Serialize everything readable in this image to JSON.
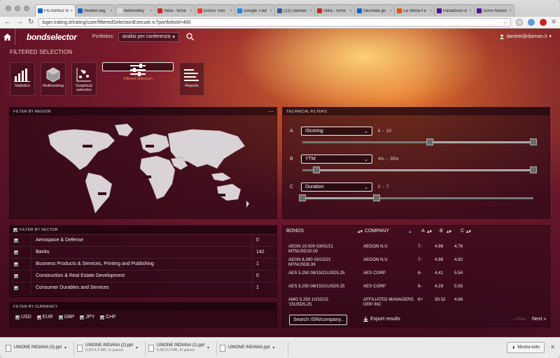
{
  "browser": {
    "tabs": [
      {
        "title": "FILTERED SE",
        "color": "#1565c0",
        "active": true
      },
      {
        "title": "modelli seg",
        "color": "#1565c0"
      },
      {
        "title": "federvolley",
        "color": "#dddddd"
      },
      {
        "title": "India - forse",
        "color": "#c62828"
      },
      {
        "title": "Enrico Tres",
        "color": "#e53935"
      },
      {
        "title": "Google Trad",
        "color": "#1e88e5"
      },
      {
        "title": "(12) Diaman",
        "color": "#3b5998"
      },
      {
        "title": "India - forse",
        "color": "#c62828"
      },
      {
        "title": "Seconda gu",
        "color": "#1565c0"
      },
      {
        "title": "La Storia Fa",
        "color": "#e65100"
      },
      {
        "title": "Paradosso d",
        "color": "#4a148c"
      },
      {
        "title": "Scrivi Nuovo",
        "color": "#4a148c"
      }
    ],
    "url": "login.irating.it/irating/user/filteredSelectionExecute.ic?portfolioId=460"
  },
  "header": {
    "logo": "bondselector",
    "portfolios_label": "Portfolios:",
    "portfolio_selected": "analisi per conferenza",
    "user": "daniele@diaman.it"
  },
  "page_title": "FILTERED SELECTION",
  "nav_icons": [
    {
      "label": "Statistics",
      "icon": "bar-chart-icon"
    },
    {
      "label": "Multiranking",
      "icon": "hexagon-icon"
    },
    {
      "label": "Graphical selection",
      "icon": "scatter-icon"
    },
    {
      "label": "Filtered selection",
      "icon": "sliders-icon",
      "selected": true
    },
    {
      "label": "Reports",
      "icon": "list-icon"
    }
  ],
  "region": {
    "title": "FILTER BY REGION"
  },
  "technical": {
    "title": "TECHNICAL FILTERS",
    "filters": [
      {
        "letter": "A",
        "metric": "IScoring",
        "min": "6",
        "max": "10",
        "low_frac": 0.55,
        "high_frac": 1.0
      },
      {
        "letter": "B",
        "metric": "YTM",
        "min": "4%",
        "max": "55%",
        "low_frac": 0.06,
        "high_frac": 1.0
      },
      {
        "letter": "C",
        "metric": "Duration",
        "min": "0",
        "max": "7",
        "low_frac": 0.0,
        "high_frac": 0.32
      }
    ]
  },
  "sector": {
    "title": "FILTER BY SECTOR",
    "rows": [
      {
        "name": "Aerospace & Defense",
        "count": "0"
      },
      {
        "name": "Banks",
        "count": "142"
      },
      {
        "name": "Business Products & Services, Printing and Publishing",
        "count": "1"
      },
      {
        "name": "Construction & Real Estate Development",
        "count": "0"
      },
      {
        "name": "Consumer Durables and Services",
        "count": "1"
      }
    ]
  },
  "currency": {
    "title": "FILTER BY CURRENCY",
    "items": [
      "USD",
      "EUR",
      "GBP",
      "JPY",
      "CHF"
    ]
  },
  "bonds": {
    "headers": {
      "bonds": "BONDS",
      "company": "COMPANY",
      "a": "A",
      "b": "B",
      "c": "C"
    },
    "rows": [
      {
        "bond": "AEGN 10.000 03/01/21 MTNUSD10.00",
        "company": "AEGON N.V.",
        "a": "7-",
        "b": "4.98",
        "c": "4.76"
      },
      {
        "bond": "AEGN 8.390 03/15/21 MTNUSD8.39",
        "company": "AEGON N.V.",
        "a": "7-",
        "b": "4.98",
        "c": "4.92"
      },
      {
        "bond": "AES 5.250 08/15/21USD5.25",
        "company": "AES CORP",
        "a": "6-",
        "b": "4.41",
        "c": "5.54"
      },
      {
        "bond": "AES 5.250 08/15/21USD5.25",
        "company": "AES CORP",
        "a": "6-",
        "b": "4.28",
        "c": "5.55"
      },
      {
        "bond": "AMG 5.250 10/15/22 '15USD5.25",
        "company": "AFFILIATED MANAGERS GRP INC",
        "a": "6+",
        "b": "30.52",
        "c": "4.66"
      }
    ],
    "search_button": "Search ISIN/company..",
    "export": "Export results",
    "prev": "« Prev",
    "next": "Next »"
  },
  "downloads": {
    "items": [
      {
        "name": "UNIONE INDIANA (3).ppt",
        "status": ""
      },
      {
        "name": "UNIONE INDIANA (2).ppt",
        "status": "3,8/14,3 MB, In pausa"
      },
      {
        "name": "UNIONE INDIANA (1).ppt",
        "status": "5,8/14,3 MB, In pausa"
      },
      {
        "name": "UNIONE INDIANA.ppt",
        "status": ""
      }
    ],
    "show_all": "Mostra tutto"
  },
  "colors": {
    "accent": "#f0a050",
    "panel": "#2a0614"
  }
}
